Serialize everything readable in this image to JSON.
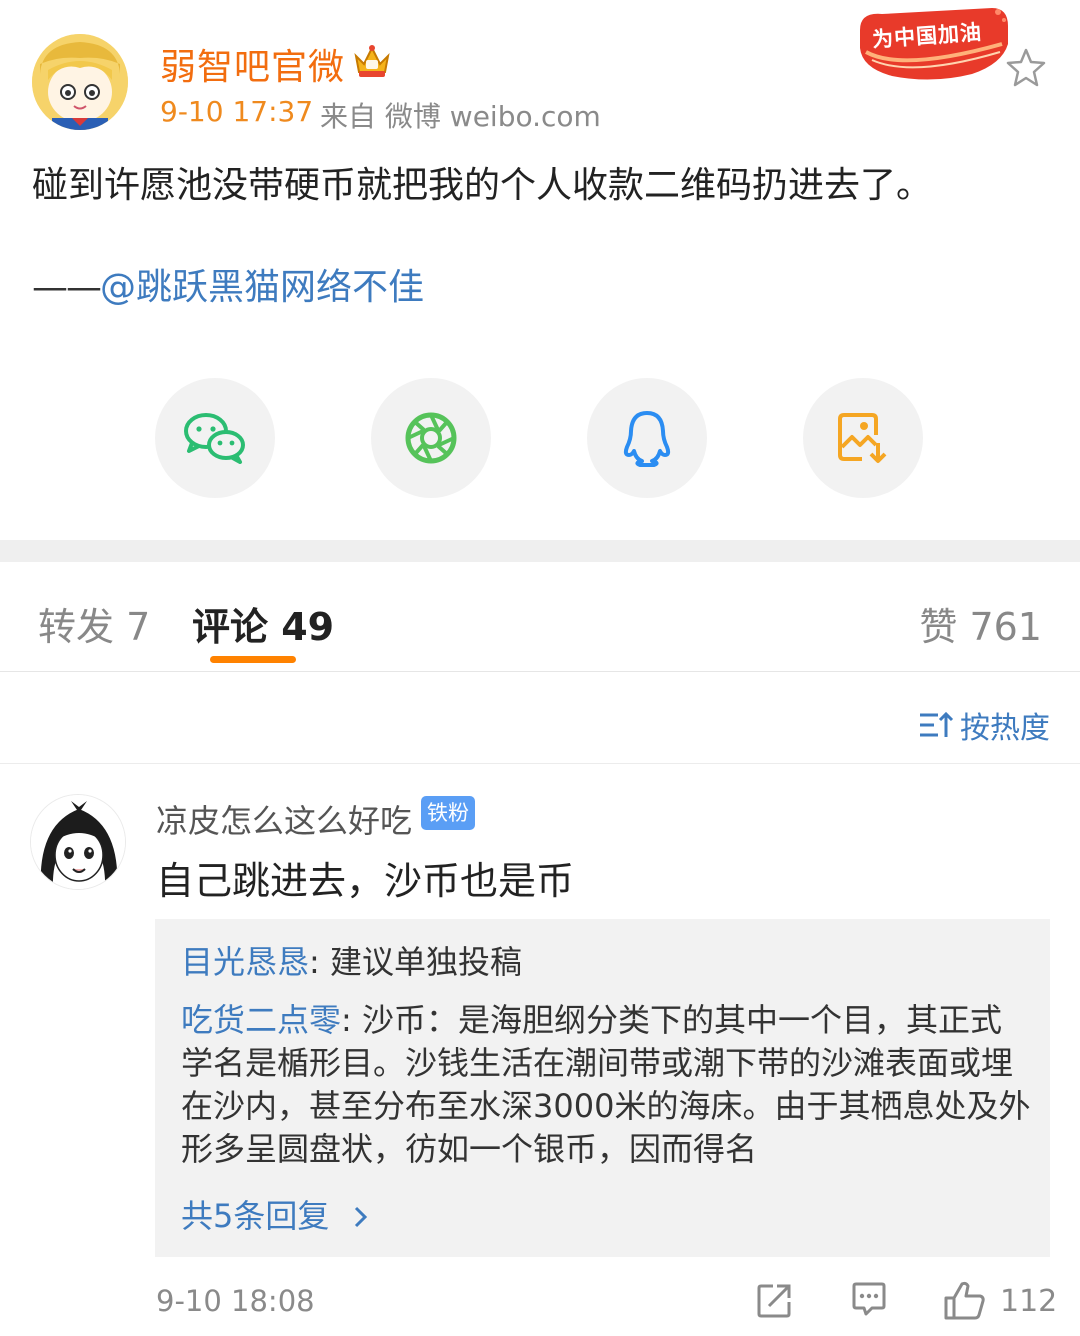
{
  "post": {
    "author": "弱智吧官微",
    "time": "9-10 17:37",
    "source": "来自 微博 weibo.com",
    "campaign_badge": "为中国加油",
    "text": "碰到许愿池没带硬币就把我的个人收款二维码扔进去了。",
    "credit_prefix": "——",
    "credit_link": "@跳跃黑猫网络不佳"
  },
  "share": {
    "items": [
      "wechat-icon",
      "moments-icon",
      "qq-icon",
      "save-image-icon"
    ],
    "colors": {
      "wechat": "#2bbd72",
      "moments": "#56c35a",
      "qq": "#2b8df2",
      "save": "#f5a623"
    }
  },
  "tabs": {
    "repost": "转发 7",
    "comments": "评论 49",
    "likes": "赞 761"
  },
  "sort": {
    "label": "按热度"
  },
  "comment": {
    "user": "凉皮怎么这么好吃",
    "badge": "铁粉",
    "text": "自己跳进去，沙币也是币",
    "replies": [
      {
        "user": "目光恳恳",
        "text": ": 建议单独投稿"
      },
      {
        "user": "吃货二点零",
        "text": ": 沙币：是海胆纲分类下的其中一个目，其正式学名是楯形目。沙钱生活在潮间带或潮下带的沙滩表面或埋在沙内，甚至分布至水深3000米的海床。由于其栖息处及外形多呈圆盘状，彷如一个银币，因而得名"
      }
    ],
    "more_replies": "共5条回复",
    "time": "9-10 18:08",
    "likes": "112"
  },
  "colors": {
    "accent": "#ff8200",
    "link": "#3e7bbf",
    "author": "#f26d0f"
  }
}
